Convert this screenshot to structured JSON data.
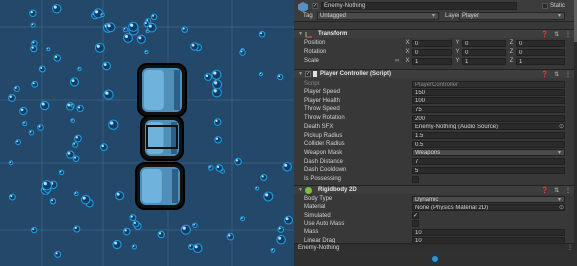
{
  "scene": {
    "view": "scene-view"
  },
  "header": {
    "object_name": "Enemy-Nothing",
    "static_label": "Static",
    "tag_label": "Tag",
    "tag_value": "Untagged",
    "layer_label": "Layer",
    "layer_value": "Player"
  },
  "transform": {
    "title": "Transform",
    "position": {
      "label": "Position",
      "x": "0",
      "y": "0",
      "z": "0"
    },
    "rotation": {
      "label": "Rotation",
      "x": "0",
      "y": "0",
      "z": "0"
    },
    "scale": {
      "label": "Scale",
      "x": "1",
      "y": "1",
      "z": "1"
    }
  },
  "player_controller": {
    "title": "Player Controller (Script)",
    "script": {
      "label": "Script",
      "value": "PlayerController"
    },
    "fields": [
      {
        "label": "Player Speed",
        "value": "150"
      },
      {
        "label": "Player Health",
        "value": "100"
      },
      {
        "label": "Throw Speed",
        "value": "75"
      },
      {
        "label": "Throw Rotation",
        "value": "200"
      },
      {
        "label": "Death SFX",
        "value": "Enemy-Nothing (Audio Source)"
      },
      {
        "label": "Pickup Radius",
        "value": "1.5"
      },
      {
        "label": "Collider Radius",
        "value": "0.5"
      },
      {
        "label": "Weapon Mask",
        "value": "Weapons"
      },
      {
        "label": "Dash Distance",
        "value": "7"
      },
      {
        "label": "Dash Cooldown",
        "value": "5"
      },
      {
        "label": "Is Possessing",
        "value": ""
      }
    ]
  },
  "rigidbody": {
    "title": "Rigidbody 2D",
    "fields": [
      {
        "label": "Body Type",
        "value": "Dynamic"
      },
      {
        "label": "Material",
        "value": "None (Physics Material 2D)"
      },
      {
        "label": "Simulated",
        "value": "✓"
      },
      {
        "label": "Use Auto Mass",
        "value": ""
      },
      {
        "label": "Mass",
        "value": "10"
      },
      {
        "label": "Linear Drag",
        "value": "10"
      }
    ]
  },
  "footer": {
    "object_name": "Enemy-Nothing"
  },
  "colors": {
    "scene_bg": "#24486a",
    "inspector_bg": "#383838",
    "blob": "#4f8fb8",
    "bubble": "#1e9be0"
  }
}
